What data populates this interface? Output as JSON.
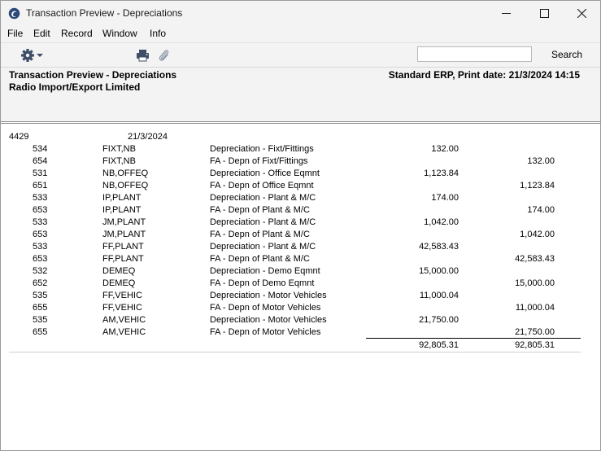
{
  "window": {
    "title": "Transaction Preview - Depreciations"
  },
  "menu": [
    "File",
    "Edit",
    "Record",
    "Window",
    "Info"
  ],
  "toolbar": {
    "search_value": "",
    "search_label": "Search"
  },
  "report": {
    "title": "Transaction Preview - Depreciations",
    "company": "Radio Import/Export Limited",
    "meta": "Standard ERP, Print date: 21/3/2024 14:15"
  },
  "transaction": {
    "number": "4429",
    "date": "21/3/2024"
  },
  "rows": [
    {
      "account": "534",
      "objects": "FIXT,NB",
      "description": "Depreciation - Fixt/Fittings",
      "debit": "132.00",
      "credit": ""
    },
    {
      "account": "654",
      "objects": "FIXT,NB",
      "description": "FA - Depn of Fixt/Fittings",
      "debit": "",
      "credit": "132.00"
    },
    {
      "account": "531",
      "objects": "NB,OFFEQ",
      "description": "Depreciation - Office Eqmnt",
      "debit": "1,123.84",
      "credit": ""
    },
    {
      "account": "651",
      "objects": "NB,OFFEQ",
      "description": "FA - Depn of Office Eqmnt",
      "debit": "",
      "credit": "1,123.84"
    },
    {
      "account": "533",
      "objects": "IP,PLANT",
      "description": "Depreciation - Plant & M/C",
      "debit": "174.00",
      "credit": ""
    },
    {
      "account": "653",
      "objects": "IP,PLANT",
      "description": "FA - Depn of Plant & M/C",
      "debit": "",
      "credit": "174.00"
    },
    {
      "account": "533",
      "objects": "JM,PLANT",
      "description": "Depreciation - Plant & M/C",
      "debit": "1,042.00",
      "credit": ""
    },
    {
      "account": "653",
      "objects": "JM,PLANT",
      "description": "FA - Depn of Plant & M/C",
      "debit": "",
      "credit": "1,042.00"
    },
    {
      "account": "533",
      "objects": "FF,PLANT",
      "description": "Depreciation - Plant & M/C",
      "debit": "42,583.43",
      "credit": ""
    },
    {
      "account": "653",
      "objects": "FF,PLANT",
      "description": "FA - Depn of Plant & M/C",
      "debit": "",
      "credit": "42,583.43"
    },
    {
      "account": "532",
      "objects": "DEMEQ",
      "description": "Depreciation - Demo Eqmnt",
      "debit": "15,000.00",
      "credit": ""
    },
    {
      "account": "652",
      "objects": "DEMEQ",
      "description": "FA - Depn of Demo Eqmnt",
      "debit": "",
      "credit": "15,000.00"
    },
    {
      "account": "535",
      "objects": "FF,VEHIC",
      "description": "Depreciation - Motor Vehicles",
      "debit": "11,000.04",
      "credit": ""
    },
    {
      "account": "655",
      "objects": "FF,VEHIC",
      "description": "FA - Depn of Motor Vehicles",
      "debit": "",
      "credit": "11,000.04"
    },
    {
      "account": "535",
      "objects": "AM,VEHIC",
      "description": "Depreciation - Motor Vehicles",
      "debit": "21,750.00",
      "credit": ""
    },
    {
      "account": "655",
      "objects": "AM,VEHIC",
      "description": "FA - Depn of Motor Vehicles",
      "debit": "",
      "credit": "21,750.00"
    }
  ],
  "totals": {
    "debit": "92,805.31",
    "credit": "92,805.31"
  },
  "icons": {
    "app": "app-logo-icon",
    "minimize": "minimize-icon",
    "maximize": "maximize-icon",
    "close": "close-icon",
    "operations": "gear-icon",
    "print": "printer-icon",
    "attach": "paperclip-icon"
  }
}
